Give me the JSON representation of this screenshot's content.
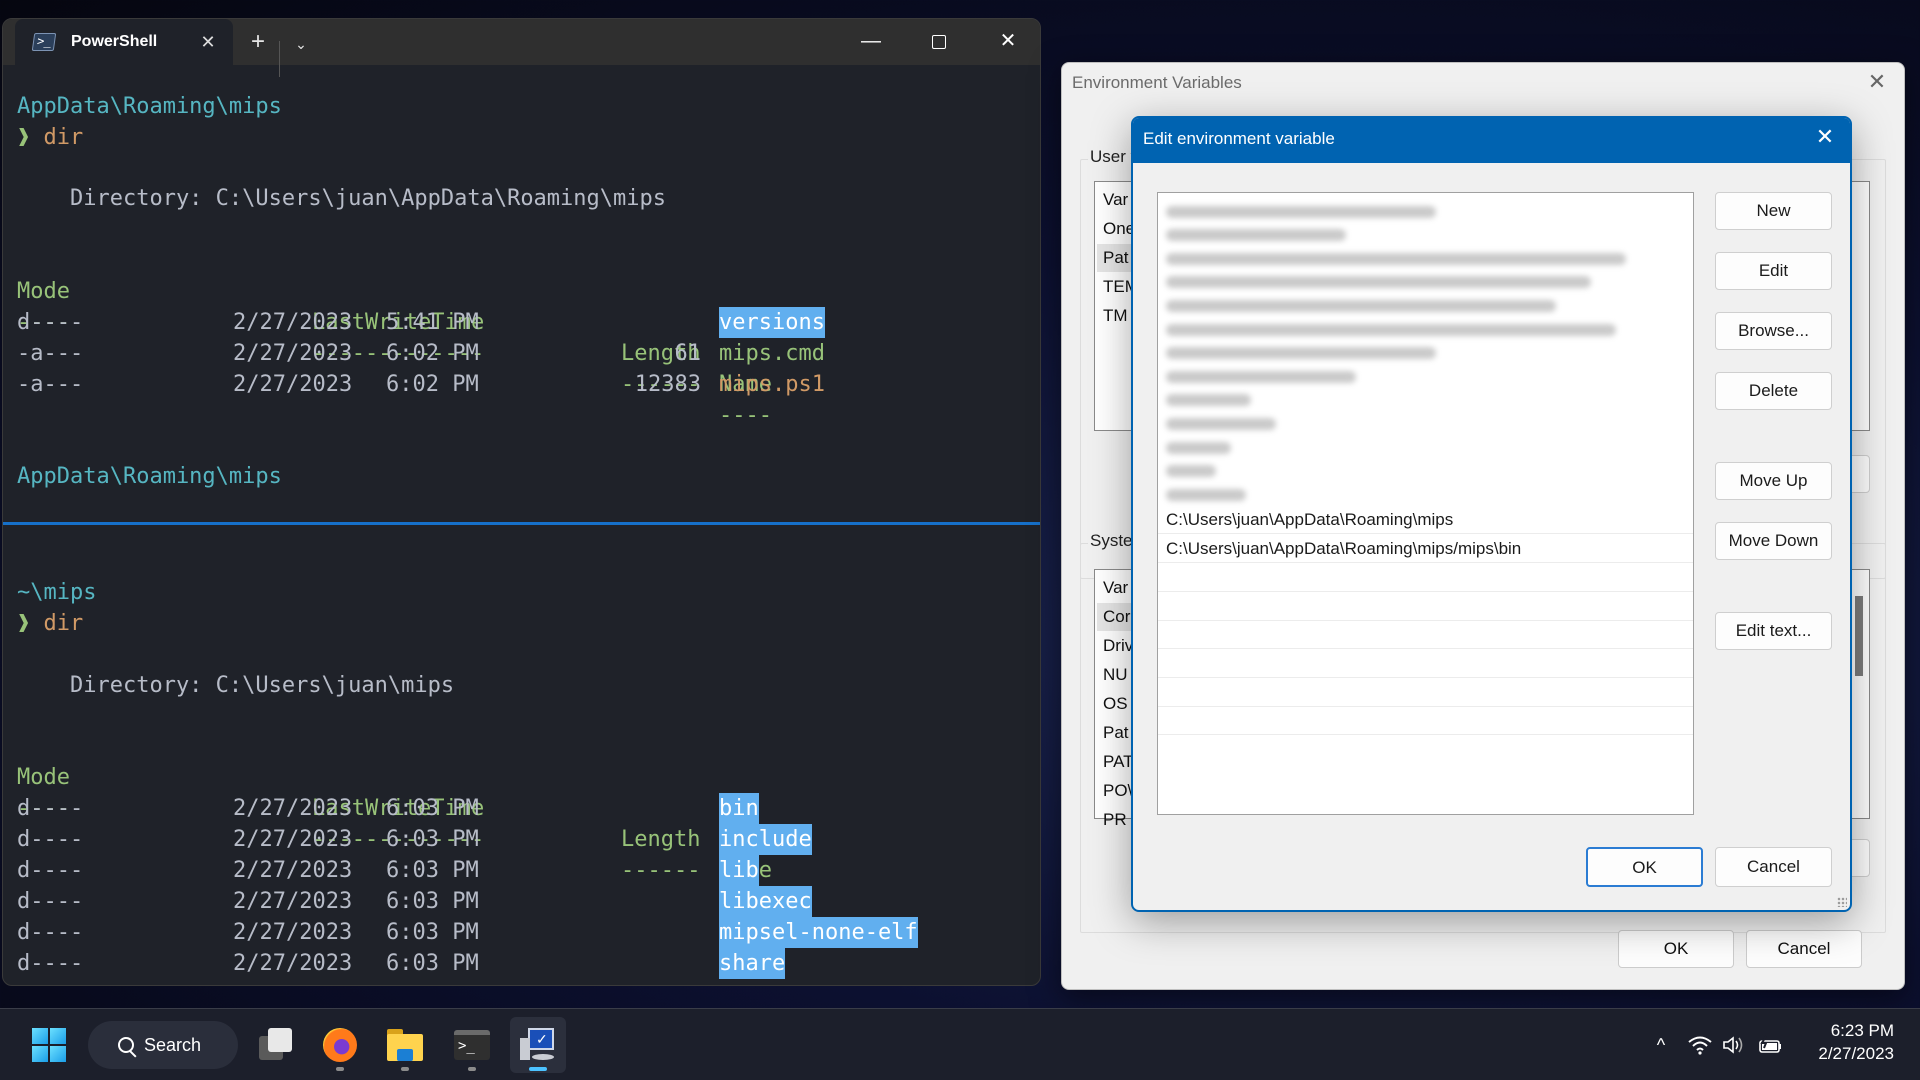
{
  "terminal": {
    "tab_title": "PowerShell",
    "tab_close_glyph": "✕",
    "new_tab_glyph": "+",
    "dropdown_glyph": "⌄",
    "minimize_glyph": "—",
    "close_glyph": "✕",
    "top_pane": {
      "prompt_path": "AppData\\Roaming\\mips",
      "prompt_arrow": "❱",
      "command": "dir",
      "directory_line": "    Directory: C:\\Users\\juan\\AppData\\Roaming\\mips",
      "headers": {
        "mode": "Mode",
        "time": "LastWriteTime",
        "length": "Length",
        "name": "Name"
      },
      "underlines": {
        "mode": "----",
        "time": "-------------",
        "length": "------",
        "name": "----"
      },
      "rows": [
        {
          "mode": "d----",
          "date": "2/27/2023",
          "time": "5:41 PM",
          "length": "",
          "name": "versions",
          "kind": "dir"
        },
        {
          "mode": "-a---",
          "date": "2/27/2023",
          "time": "6:02 PM",
          "length": "61",
          "name": "mips.cmd",
          "kind": "cmd"
        },
        {
          "mode": "-a---",
          "date": "2/27/2023",
          "time": "6:02 PM",
          "length": "12383",
          "name": "mips.ps1",
          "kind": "ps1"
        }
      ],
      "next_prompt_path": "AppData\\Roaming\\mips"
    },
    "bottom_pane": {
      "prompt_path": "~\\mips",
      "prompt_arrow": "❱",
      "command": "dir",
      "directory_line": "    Directory: C:\\Users\\juan\\mips",
      "headers": {
        "mode": "Mode",
        "time": "LastWriteTime",
        "length": "Length",
        "name": "Name"
      },
      "underlines": {
        "mode": "----",
        "time": "-------------",
        "length": "------",
        "name": "----"
      },
      "rows": [
        {
          "mode": "d----",
          "date": "2/27/2023",
          "time": "6:03 PM",
          "length": "",
          "name": "bin",
          "kind": "dir"
        },
        {
          "mode": "d----",
          "date": "2/27/2023",
          "time": "6:03 PM",
          "length": "",
          "name": "include",
          "kind": "dir"
        },
        {
          "mode": "d----",
          "date": "2/27/2023",
          "time": "6:03 PM",
          "length": "",
          "name": "lib",
          "kind": "dir"
        },
        {
          "mode": "d----",
          "date": "2/27/2023",
          "time": "6:03 PM",
          "length": "",
          "name": "libexec",
          "kind": "dir"
        },
        {
          "mode": "d----",
          "date": "2/27/2023",
          "time": "6:03 PM",
          "length": "",
          "name": "mipsel-none-elf",
          "kind": "dir"
        },
        {
          "mode": "d----",
          "date": "2/27/2023",
          "time": "6:03 PM",
          "length": "",
          "name": "share",
          "kind": "dir"
        }
      ]
    },
    "colors": {
      "path": "#56b6c2",
      "arrow": "#98c379",
      "command": "#d19a66",
      "header": "#98c379",
      "highlight": "#61afef",
      "divider": "#1670c9"
    }
  },
  "env_dialog": {
    "title": "Environment Variables",
    "close_glyph": "✕",
    "user_group_label": "User v",
    "user_rows": [
      "Var",
      "One",
      "Pat",
      "TEM",
      "TM"
    ],
    "system_group_label": "Syste",
    "system_rows": [
      "Var",
      "Cor",
      "Driv",
      "NU",
      "OS",
      "Pat",
      "PAT",
      "PO\\",
      "PR"
    ],
    "ok_label": "OK",
    "cancel_label": "Cancel"
  },
  "edit_dialog": {
    "title": "Edit environment variable",
    "close_glyph": "✕",
    "blurred_entry_count": 13,
    "visible_entries": [
      "C:\\Users\\juan\\AppData\\Roaming\\mips",
      "C:\\Users\\juan\\AppData\\Roaming\\mips/mips\\bin"
    ],
    "empty_rows": 6,
    "buttons": {
      "new": "New",
      "edit": "Edit",
      "browse": "Browse...",
      "delete": "Delete",
      "move_up": "Move Up",
      "move_down": "Move Down",
      "edit_text": "Edit text..."
    },
    "ok_label": "OK",
    "cancel_label": "Cancel",
    "accent": "#0063b1"
  },
  "taskbar": {
    "search_label": "Search",
    "apps": [
      {
        "name": "task-view",
        "running": false
      },
      {
        "name": "firefox",
        "running": true
      },
      {
        "name": "file-explorer",
        "running": true
      },
      {
        "name": "terminal",
        "running": true
      },
      {
        "name": "system-properties",
        "running": true,
        "active": true
      }
    ],
    "tray": {
      "chevron": "^",
      "time": "6:23 PM",
      "date": "2/27/2023"
    }
  }
}
